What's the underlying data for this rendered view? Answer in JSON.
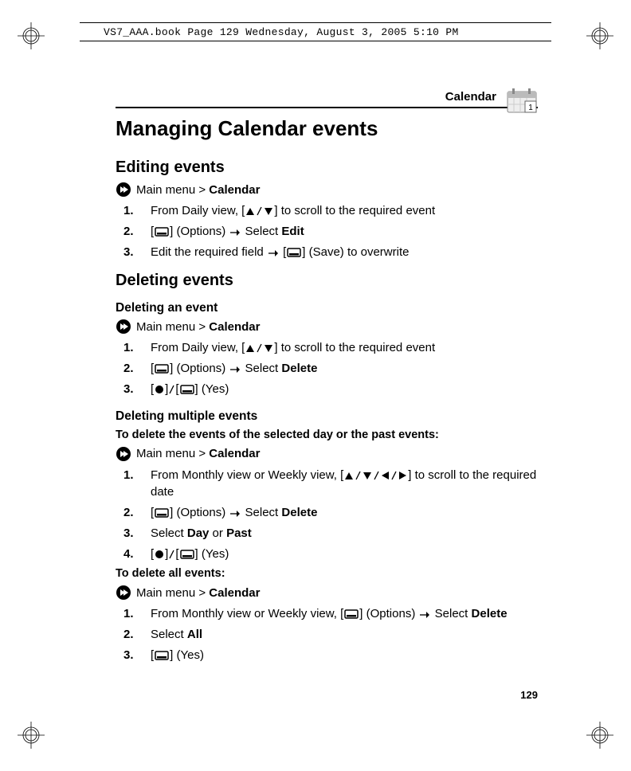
{
  "doc_header": "VS7_AAA.book  Page 129  Wednesday, August 3, 2005  5:10 PM",
  "section_label": "Calendar",
  "title": "Managing Calendar events",
  "editing": {
    "heading": "Editing events",
    "nav_pre": "Main menu > ",
    "nav_bold": "Calendar",
    "s1_a": "From Daily view, [",
    "s1_b": "] to scroll to the required event",
    "s2_a": "[",
    "s2_b": "] (Options) ",
    "s2_c": " Select ",
    "s2_bold": "Edit",
    "s3_a": "Edit the required field ",
    "s3_b": " [",
    "s3_c": "] (Save) to overwrite"
  },
  "deleting": {
    "heading": "Deleting events",
    "sub1": "Deleting an event",
    "nav_pre": "Main menu > ",
    "nav_bold": "Calendar",
    "d1_a": "From Daily view, [",
    "d1_b": "] to scroll to the required event",
    "d2_a": "[",
    "d2_b": "] (Options) ",
    "d2_c": " Select ",
    "d2_bold": "Delete",
    "d3_a": "[",
    "d3_b": "]",
    "d3_c": "[",
    "d3_d": "] (Yes)",
    "sub2": "Deleting multiple events",
    "lead1": "To delete the events of the selected day or the past events:",
    "m1_a": "From Monthly view or Weekly view, [",
    "m1_b": "] to scroll to the required date",
    "m2_a": "[",
    "m2_b": "] (Options) ",
    "m2_c": " Select ",
    "m2_bold": "Delete",
    "m3_a": "Select ",
    "m3_b1": "Day",
    "m3_or": " or ",
    "m3_b2": "Past",
    "m4_a": "[",
    "m4_b": "]",
    "m4_c": "[",
    "m4_d": "] (Yes)",
    "lead2": "To delete all events:",
    "a1_a": "From Monthly view or Weekly view, [",
    "a1_b": "] (Options) ",
    "a1_c": " Select ",
    "a1_bold": "Delete",
    "a2_a": "Select ",
    "a2_bold": "All",
    "a3_a": "[",
    "a3_b": "] (Yes)"
  },
  "page_number": "129"
}
